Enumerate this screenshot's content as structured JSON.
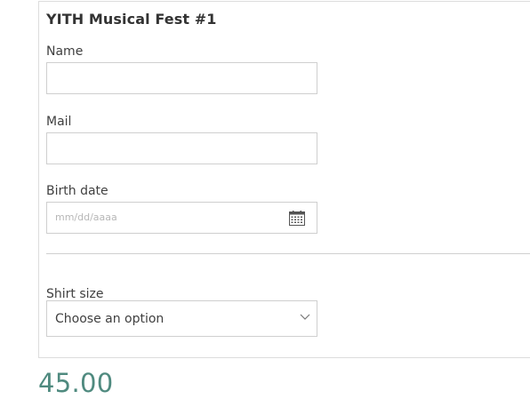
{
  "form": {
    "title": "YITH Musical Fest #1",
    "name_label": "Name",
    "name_value": "",
    "mail_label": "Mail",
    "mail_value": "",
    "birth_date_label": "Birth date",
    "birth_date_placeholder": "mm/dd/aaaa",
    "shirt_size_label": "Shirt size",
    "shirt_size_selected": "Choose an option"
  },
  "price": "45.00",
  "icons": {
    "date": "calendar-icon",
    "select": "chevron-down-icon"
  },
  "colors": {
    "price": "#4f8a7f",
    "border": "#cfcfcf",
    "text": "#404040"
  }
}
